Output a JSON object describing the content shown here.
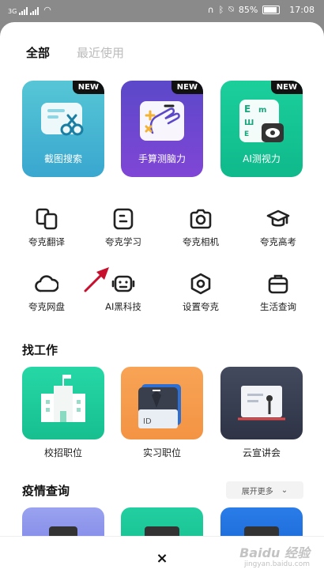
{
  "status_bar": {
    "network": "3G",
    "battery": "85%",
    "time": "17:08"
  },
  "tabs": [
    {
      "label": "全部",
      "active": true
    },
    {
      "label": "最近使用",
      "active": false
    }
  ],
  "features": [
    {
      "label": "截图搜索",
      "badge": "NEW",
      "color_top": "#56c6d6",
      "color_bottom": "#39a7cf"
    },
    {
      "label": "手算测脑力",
      "badge": "NEW",
      "color_top": "#5b48c9",
      "color_bottom": "#8046d6"
    },
    {
      "label": "AI测视力",
      "badge": "NEW",
      "color_top": "#1bcf9b",
      "color_bottom": "#0fb98b"
    }
  ],
  "grid_items": [
    {
      "label": "夸克翻译",
      "icon": "translate-icon"
    },
    {
      "label": "夸克学习",
      "icon": "study-icon"
    },
    {
      "label": "夸克相机",
      "icon": "camera-icon"
    },
    {
      "label": "夸克高考",
      "icon": "graduation-cap-icon"
    },
    {
      "label": "夸克网盘",
      "icon": "cloud-icon"
    },
    {
      "label": "AI黑科技",
      "icon": "robot-icon"
    },
    {
      "label": "设置夸克",
      "icon": "settings-icon"
    },
    {
      "label": "生活查询",
      "icon": "briefcase-icon"
    }
  ],
  "jobs": {
    "title": "找工作",
    "items": [
      {
        "label": "校招职位",
        "icon": "campus-building-icon"
      },
      {
        "label": "实习职位",
        "icon": "id-card-icon"
      },
      {
        "label": "云宣讲会",
        "icon": "lecture-board-icon"
      }
    ]
  },
  "epidemic": {
    "title": "疫情查询",
    "expand_label": "展开更多"
  },
  "close_label": "×",
  "watermark": {
    "brand": "Baidu 经验",
    "url": "jingyan.baidu.com"
  },
  "colors": {
    "annotation_arrow": "#c8102e"
  }
}
